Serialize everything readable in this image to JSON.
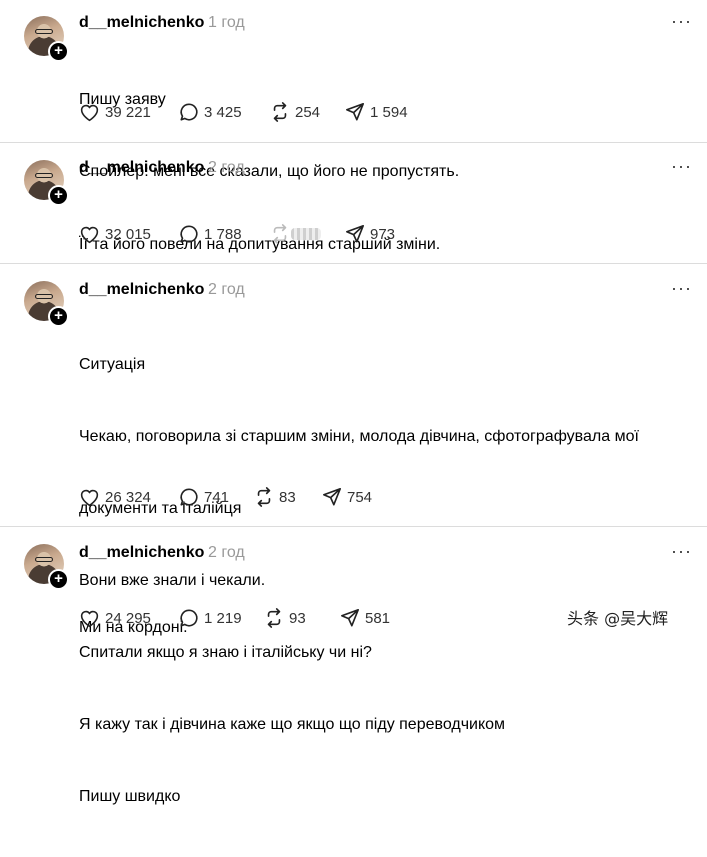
{
  "posts": [
    {
      "username": "d__melnichenko",
      "time": "1 год",
      "lines": [
        "Пишу заяву",
        "Спойлер: мені все сказали, що його не пропустять."
      ],
      "likes": "39 221",
      "comments": "3 425",
      "reposts": "254",
      "shares": "1 594"
    },
    {
      "username": "d__melnichenko",
      "time": "2 год",
      "lines": [
        "Її та його повели на допитування старший зміни."
      ],
      "likes": "32 015",
      "comments": "1 788",
      "reposts": "",
      "shares": "973"
    },
    {
      "username": "d__melnichenko",
      "time": "2 год",
      "lines": [
        "Ситуація",
        "Чекаю, поговорила зі старшим зміни, молода дівчина, сфотографувала мої",
        "документи та італійця",
        "Вони вже знали і чекали.",
        "Спитали якщо я знаю і італійську чи ні?",
        "Я кажу так і дівчина каже що якщо що піду переводчиком",
        "Пишу швидко"
      ],
      "likes": "26 324",
      "comments": "741",
      "reposts": "83",
      "shares": "754"
    },
    {
      "username": "d__melnichenko",
      "time": "2 год",
      "lines": [
        "Ми на кордоні."
      ],
      "likes": "24 295",
      "comments": "1 219",
      "reposts": "93",
      "shares": "581"
    }
  ],
  "icons": {
    "avatar": "avatar",
    "follow": "plus-icon",
    "more": "more-icon",
    "like": "heart-icon",
    "comment": "comment-icon",
    "repost": "repost-icon",
    "share": "share-icon"
  },
  "more_glyph": "···",
  "plus_glyph": "+",
  "watermark": "头条 @吴大辉"
}
